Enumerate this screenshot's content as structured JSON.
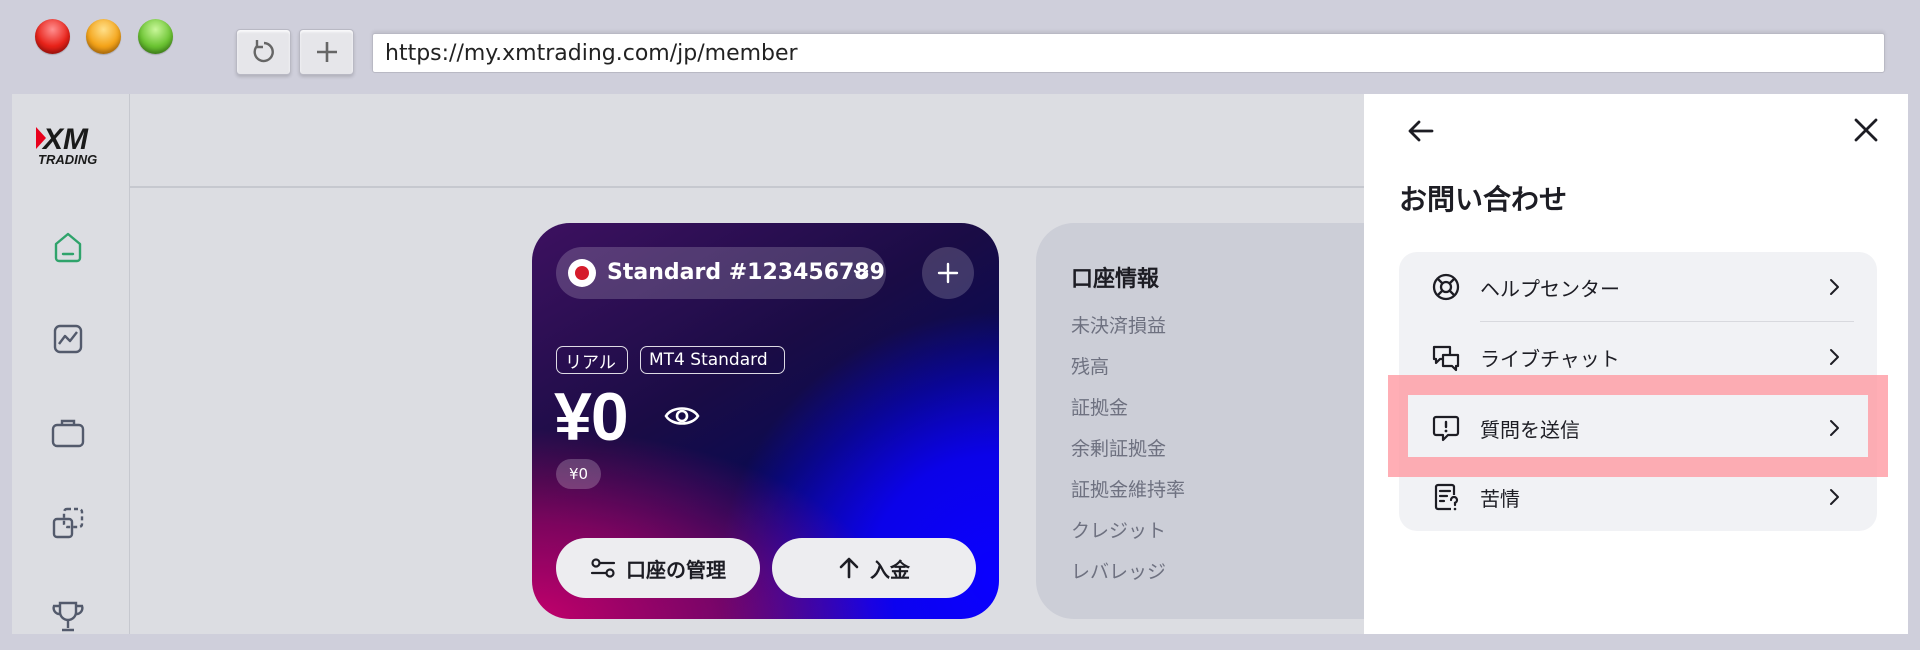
{
  "browser": {
    "url": "https://my.xmtrading.com/jp/member"
  },
  "logo": {
    "brand": "XM",
    "sub": "TRADING",
    "color_red": "#e8001c"
  },
  "sidebar": {
    "items": [
      {
        "name": "home-icon",
        "active": true
      },
      {
        "name": "chart-icon"
      },
      {
        "name": "briefcase-icon"
      },
      {
        "name": "copy-icon"
      },
      {
        "name": "trophy-icon"
      }
    ],
    "active_color": "#2fa36b"
  },
  "account_card": {
    "account_name": "Standard #123456789",
    "tags": [
      "リアル",
      "MT4 Standard"
    ],
    "balance": "¥0",
    "sub_balance": "¥0",
    "manage_label": "口座の管理",
    "deposit_label": "入金"
  },
  "account_info": {
    "title": "口座情報",
    "rows": [
      "未決済損益",
      "残高",
      "証拠金",
      "余剰証拠金",
      "証拠金維持率",
      "クレジット",
      "レバレッジ"
    ]
  },
  "drawer": {
    "title": "お問い合わせ",
    "items": [
      {
        "label": "ヘルプセンター",
        "icon": "lifebuoy-icon"
      },
      {
        "label": "ライブチャット",
        "icon": "chat-bubbles-icon"
      },
      {
        "label": "質問を送信",
        "icon": "message-alert-icon",
        "highlighted": true
      },
      {
        "label": "苦情",
        "icon": "document-question-icon"
      }
    ]
  },
  "colors": {
    "highlight": "#ff9aa2",
    "page_bg": "#dcdde2"
  }
}
